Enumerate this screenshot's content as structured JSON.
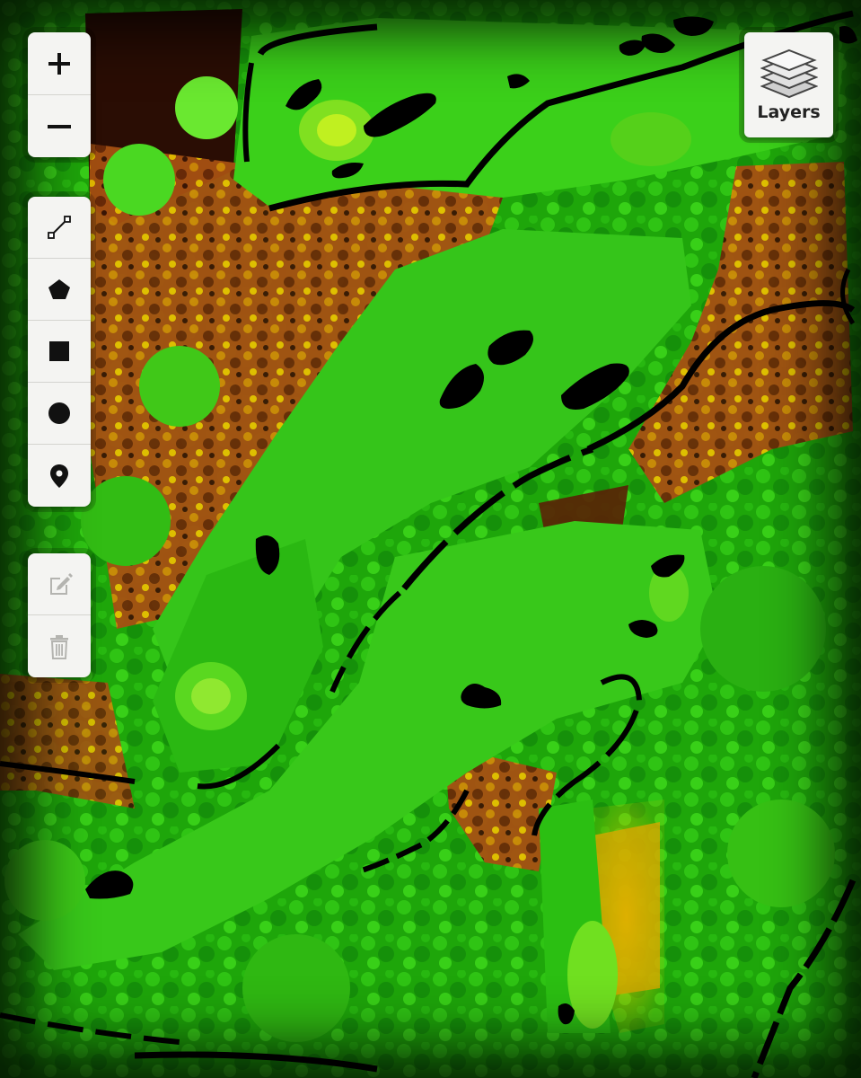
{
  "map": {
    "view": "golf-course-vegetation-index"
  },
  "zoom": {
    "in_symbol": "+",
    "out_symbol": "−"
  },
  "draw_tools": [
    {
      "name": "draw-polyline-button",
      "icon": "polyline-icon"
    },
    {
      "name": "draw-polygon-button",
      "icon": "pentagon-icon"
    },
    {
      "name": "draw-rectangle-button",
      "icon": "square-icon"
    },
    {
      "name": "draw-circle-button",
      "icon": "circle-icon"
    },
    {
      "name": "draw-marker-button",
      "icon": "map-pin-icon"
    }
  ],
  "edit_tools": [
    {
      "name": "edit-layers-button",
      "icon": "edit-icon",
      "enabled": false
    },
    {
      "name": "delete-layers-button",
      "icon": "trash-icon",
      "enabled": false
    }
  ],
  "layers": {
    "label": "Layers",
    "icon": "layers-icon"
  },
  "colors": {
    "vegetation_high": "#22d000",
    "vegetation_mid": "#7af000",
    "soil_low": "#c05a10",
    "water_bunker": "#000000"
  }
}
